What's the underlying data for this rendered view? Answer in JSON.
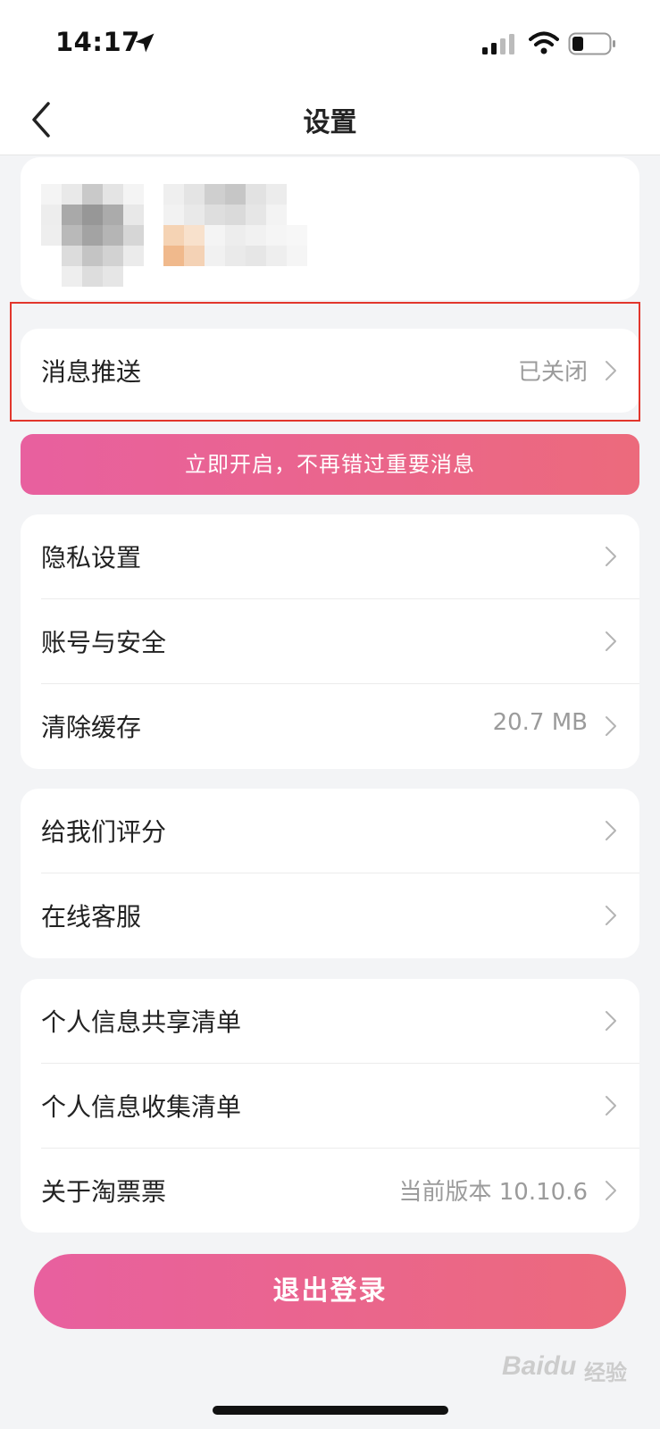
{
  "status_bar": {
    "time": "14:17",
    "icons": [
      "location-arrow-icon",
      "cellular-signal-icon",
      "wifi-icon",
      "battery-icon"
    ]
  },
  "nav": {
    "title": "设置",
    "back_icon": "chevron-left-icon"
  },
  "profile": {
    "avatar": "blurred-avatar",
    "name": "blurred-name"
  },
  "push": {
    "label": "消息推送",
    "value": "已关闭"
  },
  "banner": {
    "label": "立即开启，不再错过重要消息"
  },
  "group1": [
    {
      "label": "隐私设置",
      "value": ""
    },
    {
      "label": "账号与安全",
      "value": ""
    },
    {
      "label": "清除缓存",
      "value": "20.7 MB"
    }
  ],
  "group2": [
    {
      "label": "给我们评分",
      "value": ""
    },
    {
      "label": "在线客服",
      "value": ""
    }
  ],
  "group3": [
    {
      "label": "个人信息共享清单",
      "value": ""
    },
    {
      "label": "个人信息收集清单",
      "value": ""
    },
    {
      "label": "关于淘票票",
      "value": "当前版本 10.10.6"
    }
  ],
  "logout": {
    "label": "退出登录"
  },
  "watermark": {
    "brand": "Baidu",
    "suffix": "经验"
  },
  "colors": {
    "accent_start": "#e8609f",
    "accent_end": "#ec6a7c",
    "highlight_border": "#e2362c",
    "background": "#f3f4f6"
  }
}
